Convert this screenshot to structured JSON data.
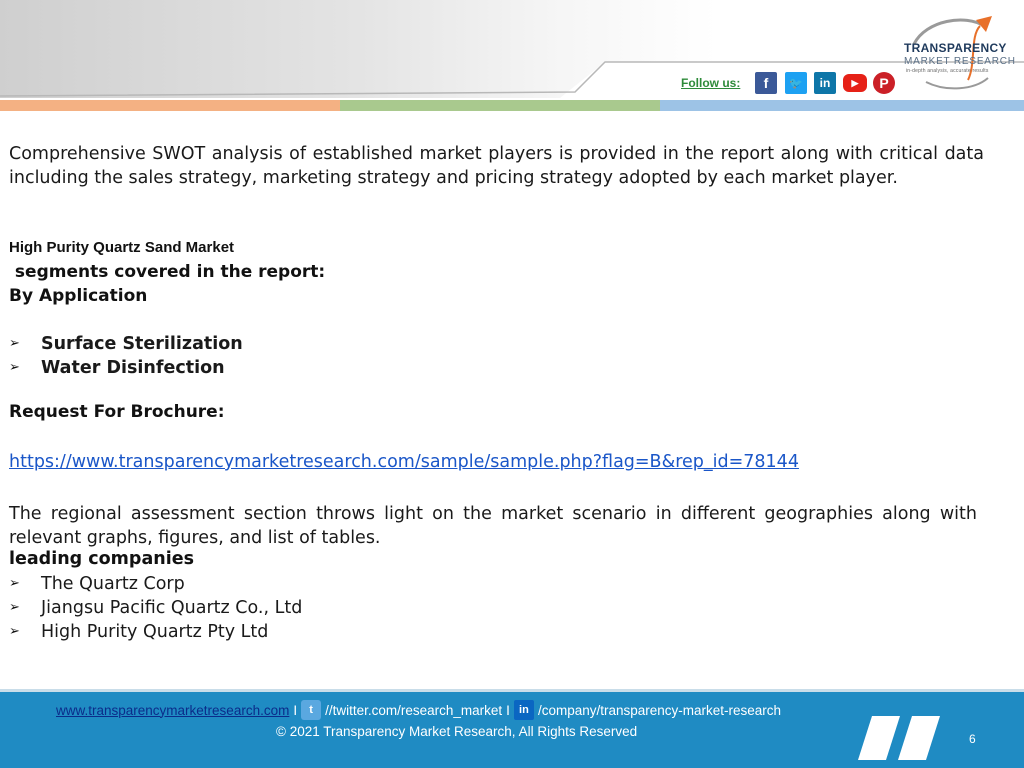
{
  "header": {
    "logo_name": "TRANSPARENCY",
    "logo_sub": "MARKET RESEARCH",
    "logo_tag": "in-depth analysis, accurate results",
    "follow_label": "Follow us:",
    "social": [
      "facebook-icon",
      "twitter-icon",
      "linkedin-icon",
      "youtube-icon",
      "pinterest-icon"
    ],
    "colors": {
      "orange_bar": "#f4b183",
      "green_bar": "#a9c98e",
      "blue_bar": "#9dc3e6"
    }
  },
  "body": {
    "intro": "Comprehensive SWOT analysis of established market players is provided in the report along with critical data including the sales strategy, marketing strategy and pricing strategy adopted by each market player.",
    "market_title": "High Purity Quartz Sand Market",
    "segments_heading": "segments covered in the report:",
    "by_application": "By Application",
    "applications": [
      "Surface Sterilization",
      "Water Disinfection"
    ],
    "request_label": "Request For Brochure:",
    "brochure_url": "https://www.transparencymarketresearch.com/sample/sample.php?flag=B&rep_id=78144",
    "regional": "The regional assessment section throws light on the market scenario in different geographies along with relevant graphs, figures, and list of tables.",
    "leading_label": "leading companies",
    "companies": [
      "The Quartz Corp",
      "Jiangsu Pacific Quartz Co., Ltd",
      "High Purity Quartz Pty Ltd"
    ]
  },
  "footer": {
    "website": "www.transparencymarketresearch.com",
    "separator": "I",
    "twitter": "//twitter.com/research_market",
    "linkedin": "/company/transparency-market-research",
    "copyright": "© 2021 Transparency Market Research, All Rights Reserved",
    "page_number": "6",
    "color": "#1f8bc3"
  }
}
